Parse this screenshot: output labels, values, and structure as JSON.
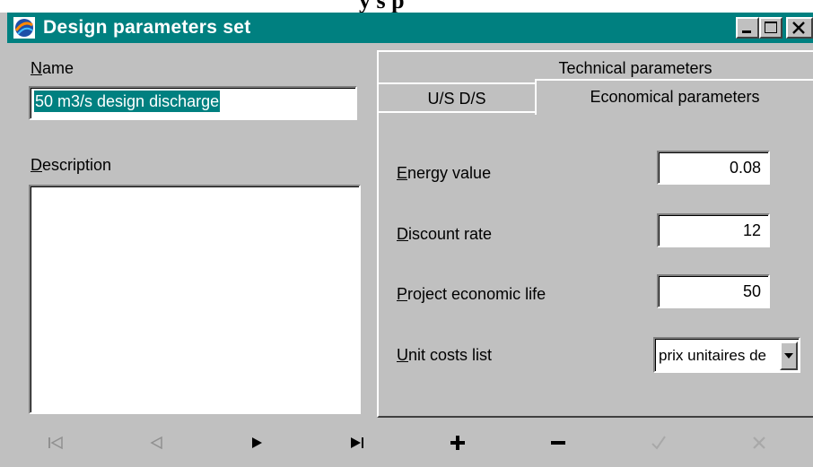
{
  "window": {
    "title": "Design parameters set",
    "cut_heading_fragment": "y  s  p",
    "titlebar_color": "#008080"
  },
  "left_panel": {
    "name_label_accel": "N",
    "name_label_rest": "ame",
    "name_value": "50 m3/s design discharge",
    "description_label_accel": "D",
    "description_label_rest": "escription",
    "description_value": ""
  },
  "tabs": {
    "technical": "Technical parameters",
    "usds": "U/S D/S",
    "economical": "Economical parameters",
    "active": "Economical parameters"
  },
  "economical": {
    "energy_label_accel": "E",
    "energy_label_rest": "nergy value",
    "energy_value": "0.08",
    "discount_label_accel": "D",
    "discount_label_rest": "iscount rate",
    "discount_value": "12",
    "life_label_accel": "P",
    "life_label_rest": "roject economic life",
    "life_value": "50",
    "unitcost_label_accel": "U",
    "unitcost_label_rest": "nit costs list",
    "unitcost_value": "prix unitaires de"
  },
  "navigator": {
    "buttons": [
      "first-icon",
      "prior-icon",
      "next-icon",
      "last-icon",
      "plus-icon",
      "minus-icon",
      "check-icon",
      "cancel-icon"
    ],
    "enabled": [
      false,
      false,
      true,
      true,
      true,
      true,
      false,
      false
    ]
  },
  "colors": {
    "face": "#c0c0c0",
    "selection": "#008080",
    "shadow": "#808080",
    "disabled": "#808080"
  }
}
